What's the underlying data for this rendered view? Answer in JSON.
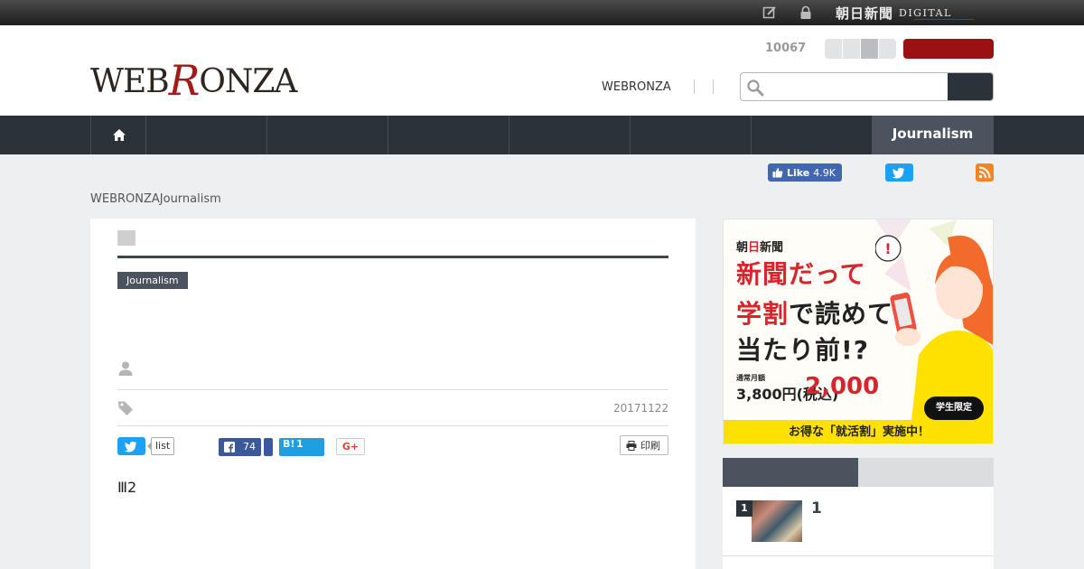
{
  "topbar": {
    "brand_jp": "朝日新聞",
    "brand_digital": "DIGITAL"
  },
  "header": {
    "logo_pre": "WEB",
    "logo_r": "R",
    "logo_post": "ONZA",
    "counter": "10067",
    "link": "WEBRONZA",
    "search_placeholder": ""
  },
  "nav": {
    "active_label": "Journalism"
  },
  "social_top": {
    "fb_like_label": "Like",
    "fb_like_count": "4.9K"
  },
  "breadcrumb": "WEBRONZAJournalism",
  "article": {
    "category": "Journalism",
    "date": "20171122",
    "share": {
      "list_label": "list",
      "fb_count": "74",
      "hatena_count": "1",
      "gplus_label": "G+"
    },
    "print_label": "印刷",
    "body": "Ⅲ2"
  },
  "ad": {
    "brand_a": "朝",
    "brand_hi": "日",
    "brand_b": "新聞",
    "line1": "新聞だって",
    "line2_red": "学割",
    "line2_rest": "で読めて",
    "line3": "当たり前!?",
    "regular_label": "通常月額",
    "regular_price": "3,800円(税込)",
    "sale_price": "2,000",
    "student_badge": "学生限定",
    "footer": "お得な「就活割」実施中！"
  },
  "ranking": {
    "items": [
      {
        "rank": "1",
        "title": "1"
      }
    ]
  },
  "colors": {
    "nav": "#2b323a",
    "accent_red": "#9b1111",
    "twitter": "#1da1f2",
    "facebook": "#3b5998"
  }
}
